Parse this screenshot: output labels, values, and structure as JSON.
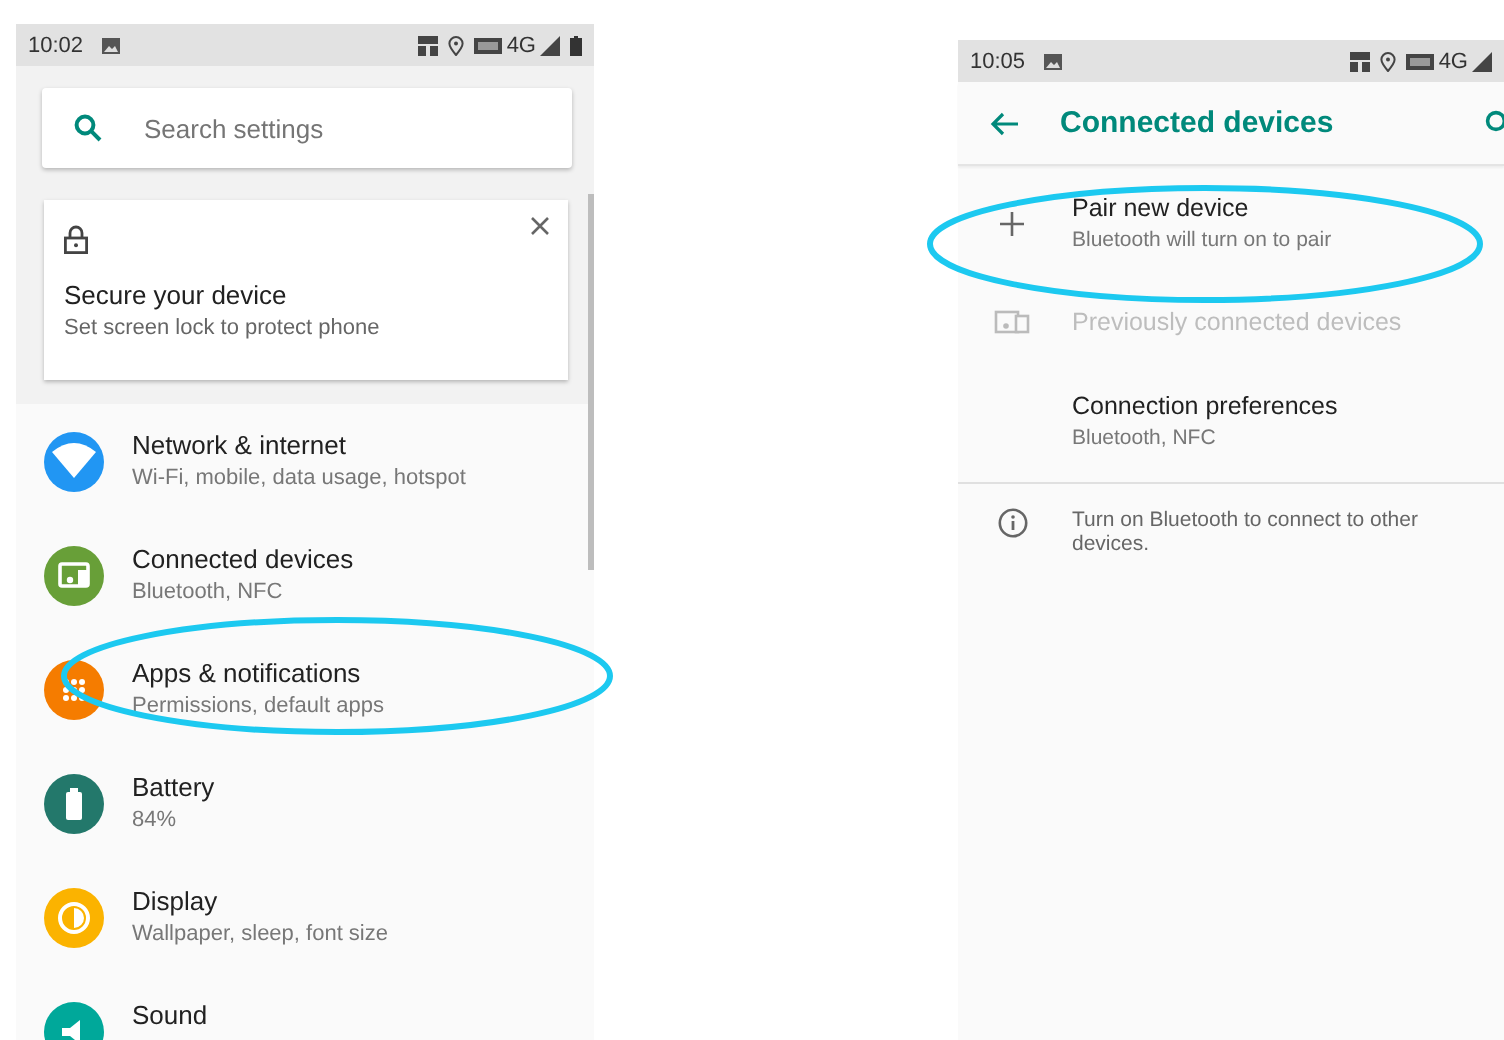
{
  "settings_screen": {
    "status_bar": {
      "time": "10:02",
      "network": "4G"
    },
    "search": {
      "placeholder": "Search settings"
    },
    "suggestion": {
      "title": "Secure your device",
      "subtitle": "Set screen lock to protect phone"
    },
    "categories": [
      {
        "kind": "wifi",
        "title": "Network & internet",
        "subtitle": "Wi-Fi, mobile, data usage, hotspot",
        "color": "#2196f3",
        "highlighted": false
      },
      {
        "kind": "devices",
        "title": "Connected devices",
        "subtitle": "Bluetooth, NFC",
        "color": "#689f38",
        "highlighted": false
      },
      {
        "kind": "apps",
        "title": "Apps & notifications",
        "subtitle": "Permissions, default apps",
        "color": "#f57c00",
        "highlighted": true
      },
      {
        "kind": "battery",
        "title": "Battery",
        "subtitle": "84%",
        "color": "#23786b",
        "highlighted": false
      },
      {
        "kind": "display",
        "title": "Display",
        "subtitle": "Wallpaper, sleep, font size",
        "color": "#fbb300",
        "highlighted": false
      },
      {
        "kind": "sound",
        "title": "Sound",
        "color": "#00a89a",
        "highlighted": false
      }
    ]
  },
  "connected_devices_screen": {
    "status_bar": {
      "time": "10:05",
      "network": "4G"
    },
    "title": "Connected devices",
    "items": [
      {
        "kind": "add",
        "title": "Pair new device",
        "subtitle": "Bluetooth will turn on to pair",
        "disabled": false,
        "highlighted": true
      },
      {
        "kind": "devices",
        "title": "Previously connected devices",
        "disabled": true,
        "highlighted": false
      },
      {
        "kind": "plain",
        "title": "Connection preferences",
        "subtitle": "Bluetooth, NFC",
        "disabled": false,
        "highlighted": false
      },
      {
        "kind": "info",
        "title": "Turn on Bluetooth to connect to other devices.",
        "disabled": false,
        "highlighted": false
      }
    ]
  }
}
